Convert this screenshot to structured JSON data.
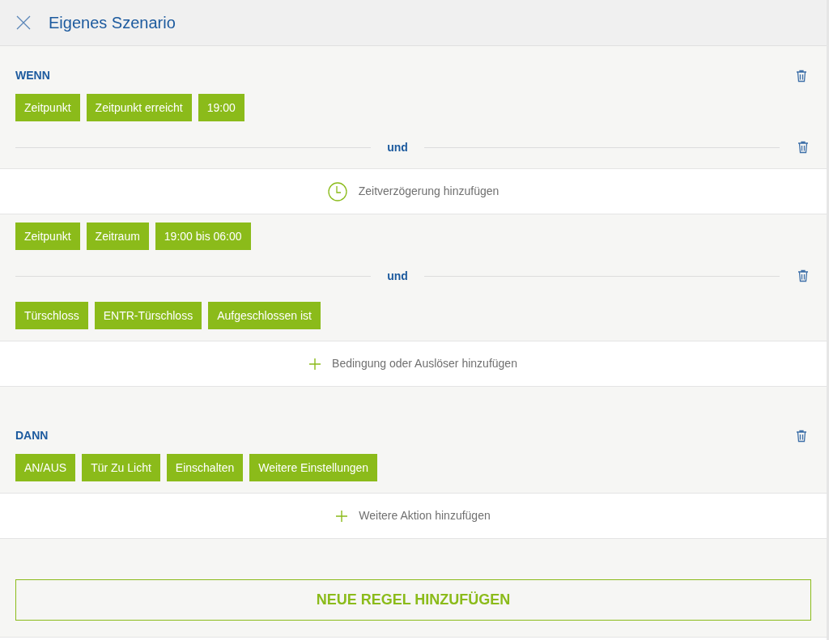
{
  "header": {
    "title": "Eigenes Szenario"
  },
  "sections": [
    {
      "title": "WENN",
      "rows": [
        {
          "kind": "chips",
          "chips": [
            "Zeitpunkt",
            "Zeitpunkt erreicht",
            "19:00"
          ]
        },
        {
          "kind": "divider",
          "label": "und"
        },
        {
          "kind": "delay",
          "label": "Zeitverzögerung hinzufügen"
        },
        {
          "kind": "chips",
          "chips": [
            "Zeitpunkt",
            "Zeitraum",
            "19:00 bis 06:00"
          ]
        },
        {
          "kind": "divider",
          "label": "und"
        },
        {
          "kind": "chips",
          "chips": [
            "Türschloss",
            "ENTR-Türschloss",
            "Aufgeschlossen ist"
          ]
        },
        {
          "kind": "add",
          "label": "Bedingung oder Auslöser hinzufügen"
        }
      ]
    },
    {
      "title": "DANN",
      "rows": [
        {
          "kind": "chips",
          "chips": [
            "AN/AUS",
            "Tür Zu Licht",
            "Einschalten",
            "Weitere Einstellungen"
          ]
        },
        {
          "kind": "add",
          "label": "Weitere Aktion hinzufügen"
        }
      ]
    }
  ],
  "new_rule_button": "NEUE REGEL HINZUFÜGEN"
}
